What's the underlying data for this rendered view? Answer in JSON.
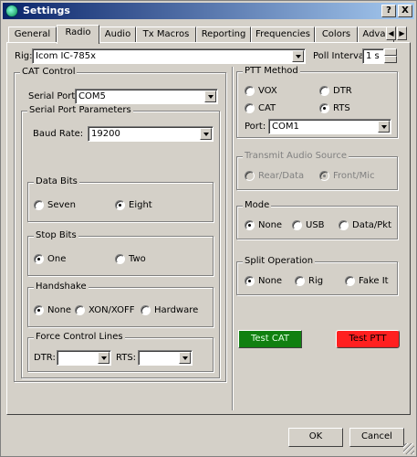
{
  "window": {
    "title": "Settings",
    "help_btn": "?",
    "close_btn": "X"
  },
  "tabs": [
    "General",
    "Radio",
    "Audio",
    "Tx Macros",
    "Reporting",
    "Frequencies",
    "Colors",
    "Advar"
  ],
  "active_tab": "Radio",
  "rig": {
    "label": "Rig:",
    "value": "Icom IC-785x"
  },
  "poll_interval": {
    "label": "Poll Interval:",
    "value": "1 s"
  },
  "cat_control": {
    "title": "CAT Control",
    "serial_port_label": "Serial Port:",
    "serial_port_value": "COM5",
    "params": {
      "title": "Serial Port Parameters",
      "baud_label": "Baud Rate:",
      "baud_value": "19200",
      "data_bits": {
        "title": "Data Bits",
        "options": [
          "Seven",
          "Eight"
        ],
        "selected": "Eight"
      },
      "stop_bits": {
        "title": "Stop Bits",
        "options": [
          "One",
          "Two"
        ],
        "selected": "One"
      },
      "handshake": {
        "title": "Handshake",
        "options": [
          "None",
          "XON/XOFF",
          "Hardware"
        ],
        "selected": "None"
      },
      "force_lines": {
        "title": "Force Control Lines",
        "dtr_label": "DTR:",
        "dtr_value": "",
        "rts_label": "RTS:",
        "rts_value": ""
      }
    }
  },
  "ptt_method": {
    "title": "PTT Method",
    "options": [
      "VOX",
      "DTR",
      "CAT",
      "RTS"
    ],
    "selected": "RTS",
    "port_label": "Port:",
    "port_value": "COM1"
  },
  "tx_audio_source": {
    "title": "Transmit Audio Source",
    "options": [
      "Rear/Data",
      "Front/Mic"
    ],
    "selected": "Front/Mic"
  },
  "mode": {
    "title": "Mode",
    "options": [
      "None",
      "USB",
      "Data/Pkt"
    ],
    "selected": "None"
  },
  "split_operation": {
    "title": "Split Operation",
    "options": [
      "None",
      "Rig",
      "Fake It"
    ],
    "selected": "None"
  },
  "test_buttons": {
    "cat_label": "Test CAT",
    "cat_color": "#108010",
    "ptt_label": "Test PTT",
    "ptt_color": "#ff2020"
  },
  "footer": {
    "ok_label": "OK",
    "cancel_label": "Cancel"
  },
  "icons": [
    "app-icon",
    "help-icon",
    "close-icon",
    "tab-scroll-left-icon",
    "tab-scroll-right-icon",
    "dropdown-arrow-icon",
    "resize-grip-icon"
  ]
}
